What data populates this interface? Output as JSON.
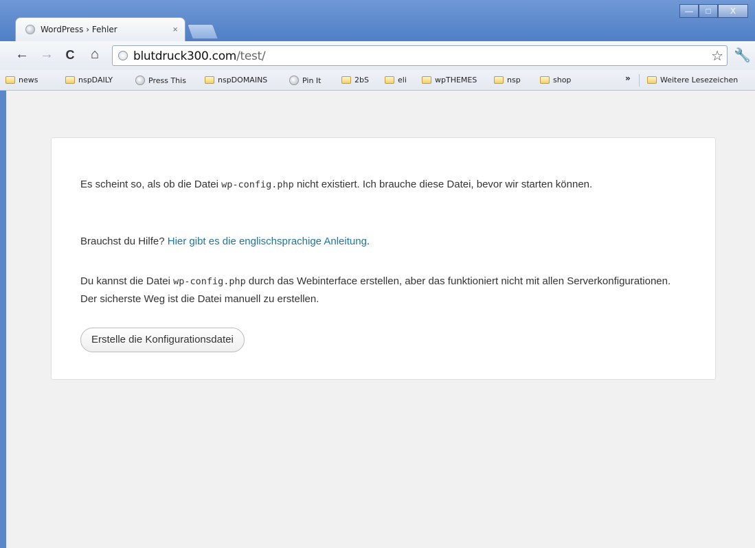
{
  "window": {
    "minimize": "—",
    "maximize": "□",
    "close": "X"
  },
  "tab": {
    "title": "WordPress › Fehler",
    "close": "×"
  },
  "toolbar": {
    "back": "←",
    "forward": "→",
    "reload": "C",
    "home": "⌂",
    "url_host": "blutdruck300.com",
    "url_path": "/test/",
    "star": "☆",
    "wrench": "🔧"
  },
  "bookmarks": {
    "items": [
      "news",
      "nspDAILY",
      "Press This",
      "nspDOMAINS",
      "Pin It",
      "2bS",
      "eli",
      "wpTHEMES",
      "nsp",
      "shop"
    ],
    "overflow": "»",
    "other": "Weitere Lesezeichen"
  },
  "page": {
    "p1_a": "Es scheint so, als ob die Datei ",
    "p1_code": "wp-config.php",
    "p1_b": " nicht existiert. Ich brauche diese Datei, bevor wir starten können.",
    "p2_a": "Brauchst du Hilfe? ",
    "p2_link": "Hier gibt es die englischsprachige Anleitung",
    "p2_b": ".",
    "p3_a": "Du kannst die Datei ",
    "p3_code": "wp-config.php",
    "p3_b": " durch das Webinterface erstellen, aber das funktioniert nicht mit allen Serverkonfigurationen. Der sicherste Weg ist die Datei manuell zu erstellen.",
    "button": "Erstelle die Konfigurationsdatei"
  }
}
